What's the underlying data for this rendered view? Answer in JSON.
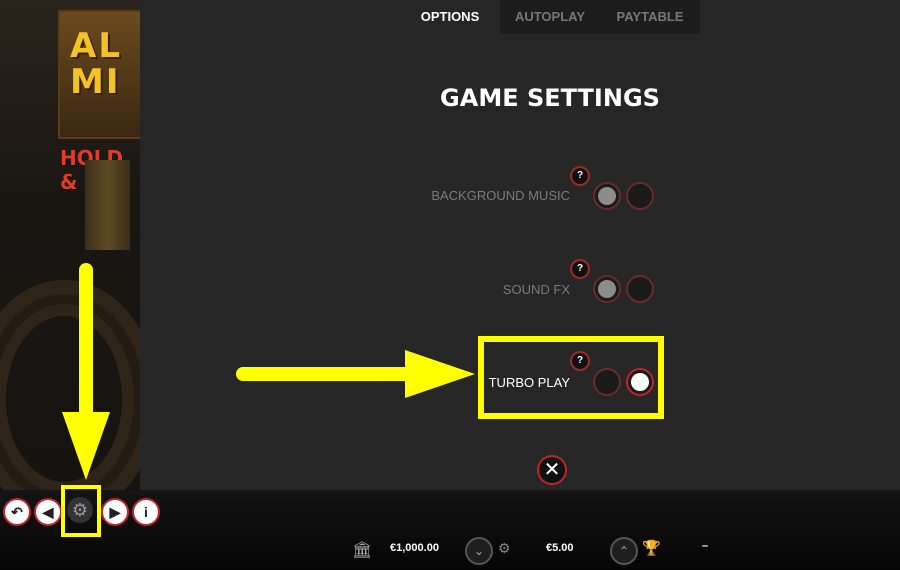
{
  "tabs": [
    {
      "label": "OPTIONS"
    },
    {
      "label": "AUTOPLAY"
    },
    {
      "label": "PAYTABLE"
    }
  ],
  "title": "GAME SETTINGS",
  "settings": [
    {
      "label": "BACKGROUND MUSIC",
      "help": "?",
      "selected": "on"
    },
    {
      "label": "SOUND FX",
      "help": "?",
      "selected": "on"
    },
    {
      "label": "TURBO PLAY",
      "help": "?",
      "selected": "on"
    }
  ],
  "close_symbol": "✕",
  "game_logo": {
    "line1": "AL",
    "line2": "MI",
    "subtitle": "HOLD &"
  },
  "footer": {
    "balance": "€1,000.00",
    "bet": "€5.00",
    "win": "–"
  },
  "icons": [
    "back-icon",
    "prev-icon",
    "gear-icon",
    "next-icon",
    "info-icon",
    "bank-icon",
    "chevron-down-icon",
    "coins-icon",
    "chevron-up-icon",
    "trophy-icon",
    "close-icon",
    "help-icon"
  ],
  "colors": {
    "accent": "#c0242b",
    "highlight": "#ffff00",
    "panel": "#262626"
  }
}
